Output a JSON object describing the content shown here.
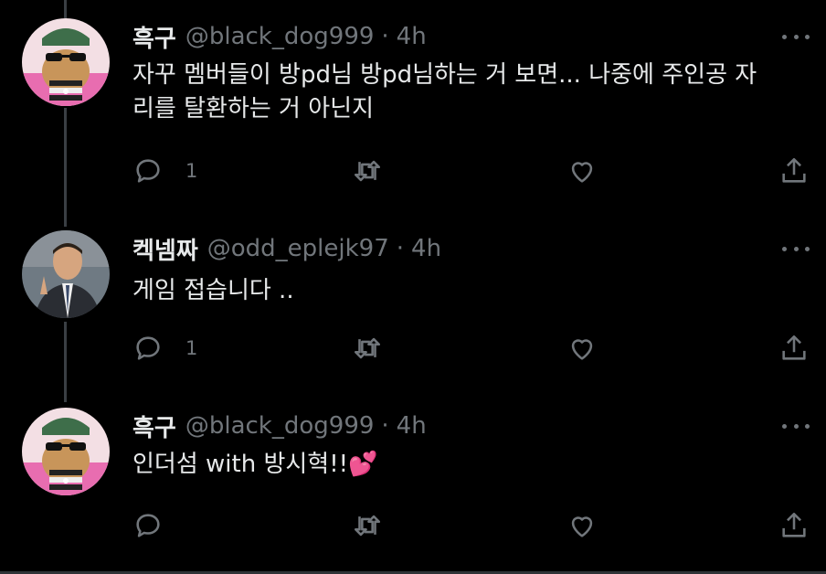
{
  "tweets": [
    {
      "name": "흑구",
      "handle": "@black_dog999",
      "dot": "·",
      "time": "4h",
      "text_line1": "자꾸 멤버들이 방pd님 방pd님하는 거 보면... 나중에 주인공 자",
      "text_line2": "리를 탈환하는 거 아닌지",
      "reply_count": "1",
      "avatar": "cat-with-sunglasses"
    },
    {
      "name": "켁넴짜",
      "handle": "@odd_eplejk97",
      "dot": "·",
      "time": "4h",
      "text_line1": "게임 접습니다 ..",
      "reply_count": "1",
      "avatar": "man-in-suit-peace-sign"
    },
    {
      "name": "흑구",
      "handle": "@black_dog999",
      "dot": "·",
      "time": "4h",
      "text_line1": "인더섬 with 방시혁!!",
      "emoji": "💕",
      "avatar": "cat-with-sunglasses"
    }
  ],
  "icons": {
    "reply": "reply-icon",
    "retweet": "retweet-icon",
    "like": "like-icon",
    "share": "share-icon",
    "more": "more-icon"
  },
  "colors": {
    "background": "#000000",
    "text": "#e7e9ea",
    "muted": "#71767b",
    "thread_line": "#3a3f44"
  }
}
